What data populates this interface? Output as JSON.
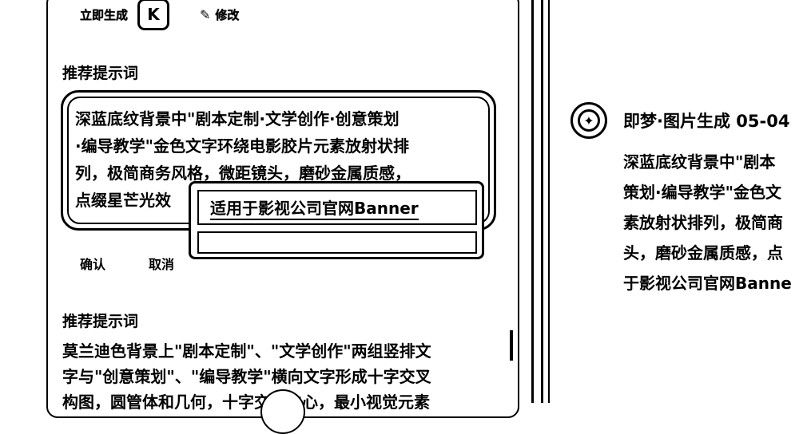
{
  "toolbar": {
    "generate_now": "立即生成",
    "logo_letter": "K",
    "edit_label": "修改"
  },
  "section1": {
    "title": "推荐提示词"
  },
  "prompt1": {
    "lines": [
      "深蓝底纹背景中\"剧本定制·文学创作·创意策划",
      "·编导教学\"金色文字环绕电影胶片元素放射状排",
      "列，极简商务风格，微距镜头，磨砂金属质感，",
      "点缀星芒光效"
    ]
  },
  "popup": {
    "input_value": "适用于影视公司官网Banner"
  },
  "actions": {
    "confirm": "确认",
    "cancel": "取消"
  },
  "section2": {
    "title": "推荐提示词"
  },
  "prompt2": {
    "lines": [
      "莫兰迪色背景上\"剧本定制\"、\"文学创作\"两组竖排文",
      "字与\"创意策划\"、\"编导教学\"横向文字形成十字交叉",
      "构图，圆管体和几何，十字交叉中心，最小视觉元素"
    ]
  },
  "right_panel": {
    "title": "即梦·图片生成 05-04",
    "lines": [
      "深蓝底纹背景中\"剧本",
      "策划·编导教学\"金色文",
      "素放射状排列，极简商",
      "头，磨砂金属质感，点",
      "于影视公司官网Banne"
    ]
  }
}
